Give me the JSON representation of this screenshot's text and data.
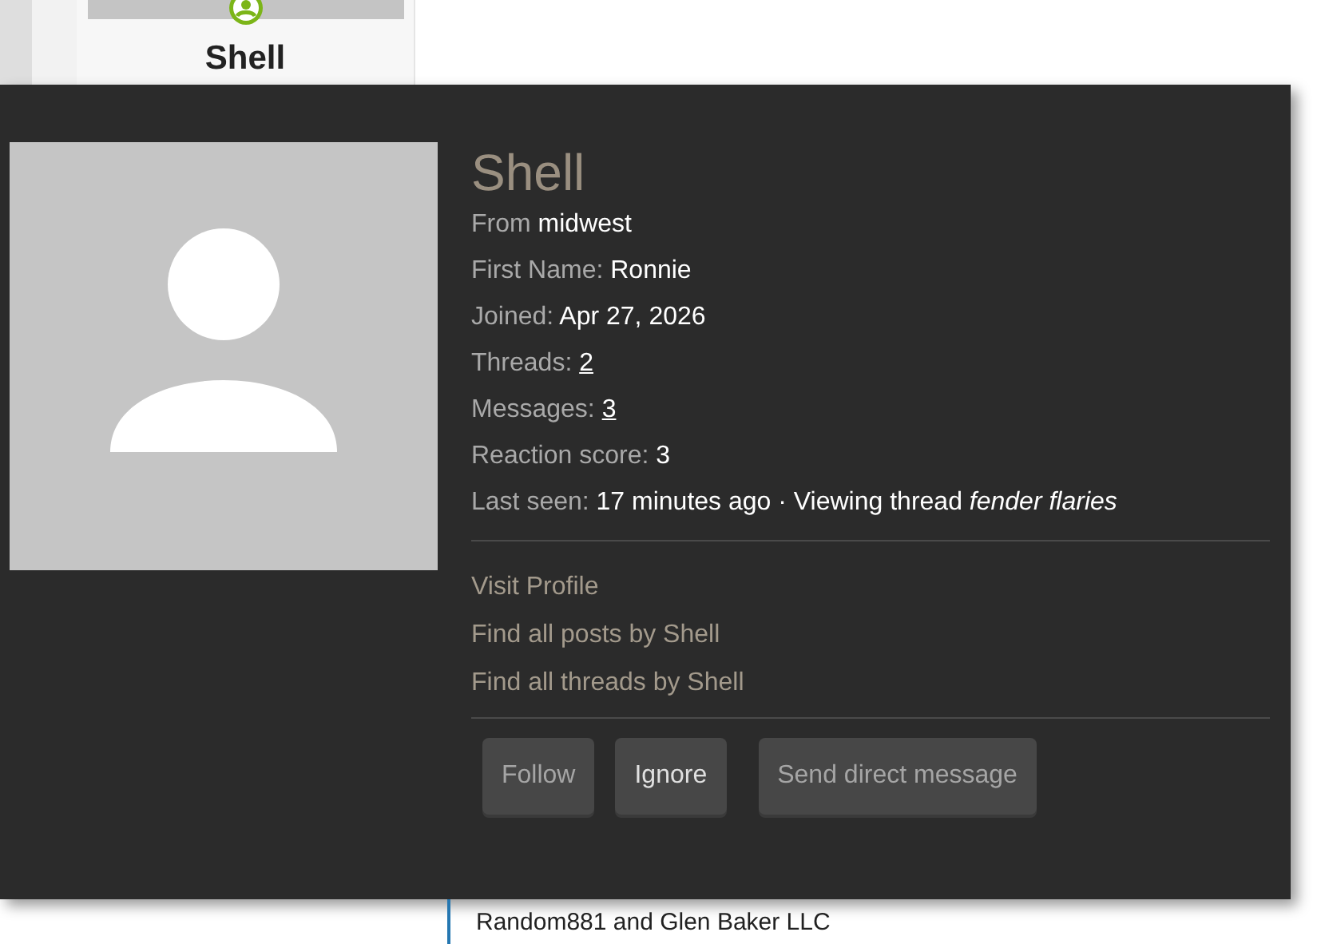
{
  "background_card": {
    "name": "Shell"
  },
  "popup": {
    "username": "Shell",
    "fields": [
      {
        "label": "From",
        "value": "midwest",
        "kind": "text"
      },
      {
        "label": "First Name:",
        "value": "Ronnie",
        "kind": "text"
      },
      {
        "label": "Joined:",
        "value": "Apr 27, 2026",
        "kind": "text"
      },
      {
        "label": "Threads:",
        "value": "2",
        "kind": "link"
      },
      {
        "label": "Messages:",
        "value": "3",
        "kind": "link"
      },
      {
        "label": "Reaction score:",
        "value": "3",
        "kind": "text"
      },
      {
        "label": "Last seen:",
        "value": "17 minutes ago · Viewing thread *fender flaries*",
        "kind": "text"
      }
    ],
    "links": [
      "Visit Profile",
      "Find all posts by Shell",
      "Find all threads by Shell"
    ],
    "buttons": [
      "Follow",
      "Ignore",
      "Send direct message"
    ]
  },
  "reactions": {
    "text": "Random881 and Glen Baker LLC"
  }
}
